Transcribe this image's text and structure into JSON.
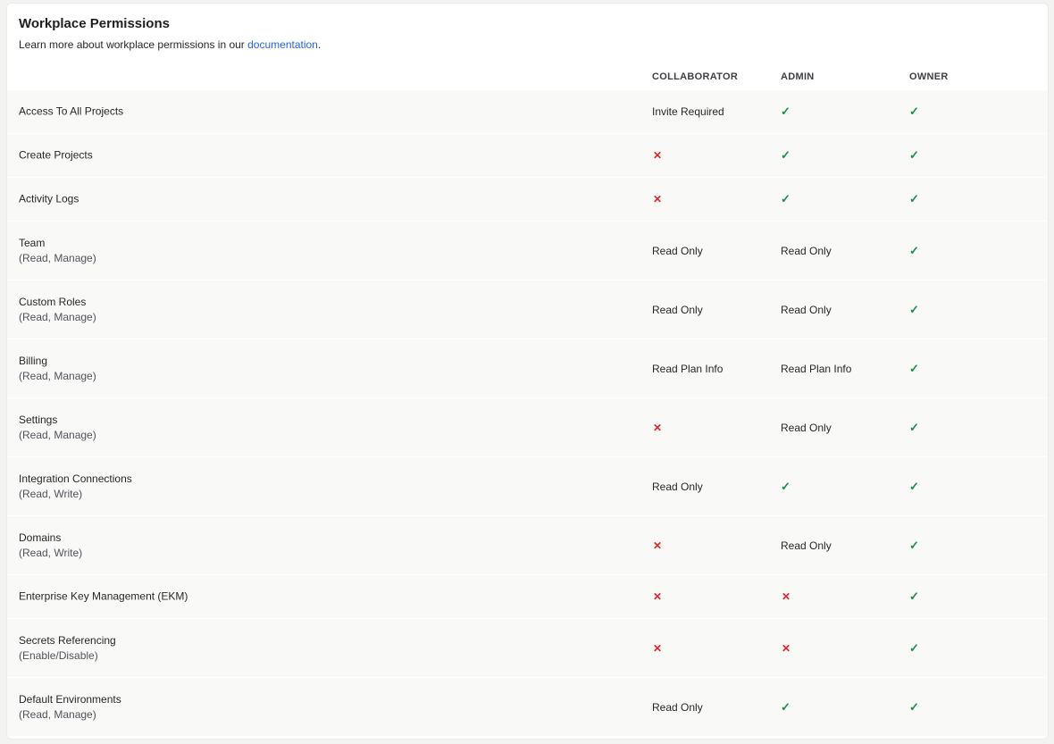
{
  "header": {
    "title": "Workplace Permissions",
    "subtitle_prefix": "Learn more about workplace permissions in our ",
    "subtitle_link": "documentation",
    "subtitle_suffix": "."
  },
  "columns": [
    "COLLABORATOR",
    "ADMIN",
    "OWNER"
  ],
  "icons": {
    "allowed": "check-icon",
    "denied": "cross-icon"
  },
  "colors": {
    "allowed": "#1f8a4c",
    "denied": "#dc2626",
    "link": "#2563eb"
  },
  "rows": [
    {
      "label": "Access To All Projects",
      "sub": "",
      "values": [
        "Invite Required",
        "check",
        "check"
      ]
    },
    {
      "label": "Create Projects",
      "sub": "",
      "values": [
        "cross",
        "check",
        "check"
      ]
    },
    {
      "label": "Activity Logs",
      "sub": "",
      "values": [
        "cross",
        "check",
        "check"
      ]
    },
    {
      "label": "Team",
      "sub": "(Read, Manage)",
      "values": [
        "Read Only",
        "Read Only",
        "check"
      ]
    },
    {
      "label": "Custom Roles",
      "sub": "(Read, Manage)",
      "values": [
        "Read Only",
        "Read Only",
        "check"
      ]
    },
    {
      "label": "Billing",
      "sub": "(Read, Manage)",
      "values": [
        "Read Plan Info",
        "Read Plan Info",
        "check"
      ]
    },
    {
      "label": "Settings",
      "sub": "(Read, Manage)",
      "values": [
        "cross",
        "Read Only",
        "check"
      ]
    },
    {
      "label": "Integration Connections",
      "sub": "(Read, Write)",
      "values": [
        "Read Only",
        "check",
        "check"
      ]
    },
    {
      "label": "Domains",
      "sub": "(Read, Write)",
      "values": [
        "cross",
        "Read Only",
        "check"
      ]
    },
    {
      "label": "Enterprise Key Management (EKM)",
      "sub": "",
      "values": [
        "cross",
        "cross",
        "check"
      ]
    },
    {
      "label": "Secrets Referencing",
      "sub": "(Enable/Disable)",
      "values": [
        "cross",
        "cross",
        "check"
      ]
    },
    {
      "label": "Default Environments",
      "sub": "(Read, Manage)",
      "values": [
        "Read Only",
        "check",
        "check"
      ]
    }
  ]
}
